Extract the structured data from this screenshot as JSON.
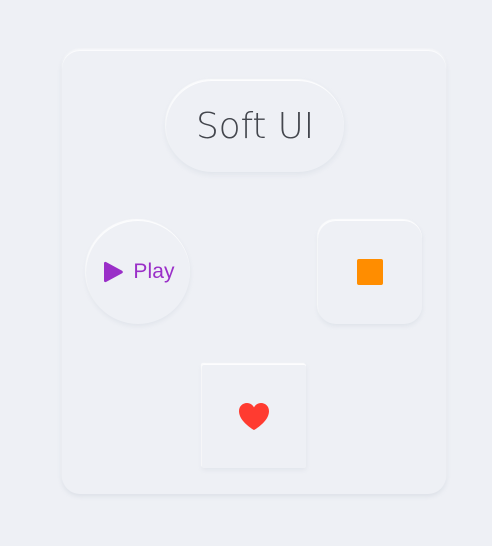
{
  "title": "Soft UI",
  "buttons": {
    "play": {
      "label": "Play",
      "icon": "play-icon",
      "color": "#9a2fc8"
    },
    "stop": {
      "icon": "stop-icon",
      "color": "#ff8d00"
    },
    "favorite": {
      "icon": "heart-icon",
      "color": "#ff3b30"
    }
  },
  "colors": {
    "background": "#eef0f5",
    "text": "#43464d"
  }
}
